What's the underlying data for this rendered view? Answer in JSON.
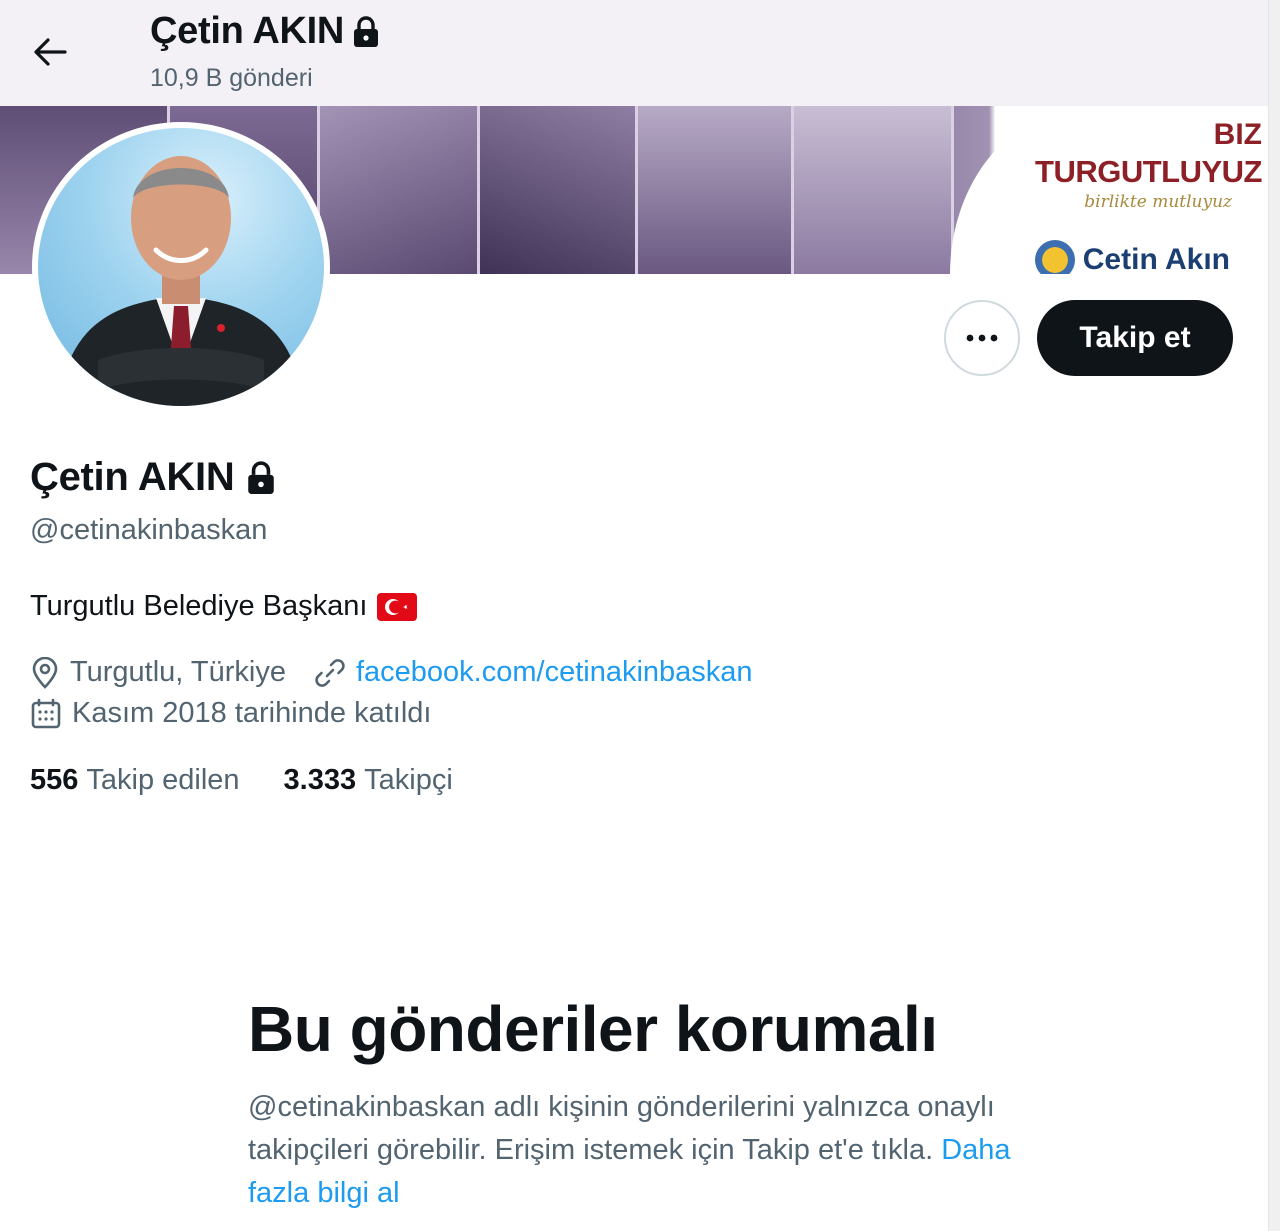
{
  "header": {
    "display_name": "Çetin AKIN",
    "posts_count": "10,9 B gönderi",
    "back_icon": "arrow-left-icon",
    "lock_icon": "lock-icon"
  },
  "banner": {
    "logo_line1": "BIZ",
    "logo_line2": "TURGUTLUYUZ",
    "logo_script": "birlikte mutluyuz",
    "logo_name": "Cetin Akın"
  },
  "actions": {
    "more_icon": "more-horizontal-icon",
    "follow_label": "Takip et"
  },
  "profile": {
    "name": "Çetin AKIN",
    "handle": "@cetinakinbaskan",
    "bio": "Turgutlu Belediye Başkanı",
    "bio_flag": "turkey-flag-emoji",
    "location": "Turgutlu, Türkiye",
    "website": "facebook.com/cetinakinbaskan",
    "joined": "Kasım 2018 tarihinde katıldı"
  },
  "stats": {
    "following_count": "556",
    "following_label": "Takip edilen",
    "followers_count": "3.333",
    "followers_label": "Takipçi"
  },
  "protected": {
    "title": "Bu gönderiler korumalı",
    "text": "@cetinakinbaskan adlı kişinin gönderilerini yalnızca onaylı takipçileri görebilir. Erişim istemek için Takip et'e tıkla.",
    "link": "Daha fazla bilgi al"
  },
  "colors": {
    "accent": "#1d9bf0",
    "text_primary": "#0f1419",
    "text_secondary": "#536471",
    "button_dark": "#0f1419",
    "flag_red": "#e30a17"
  }
}
